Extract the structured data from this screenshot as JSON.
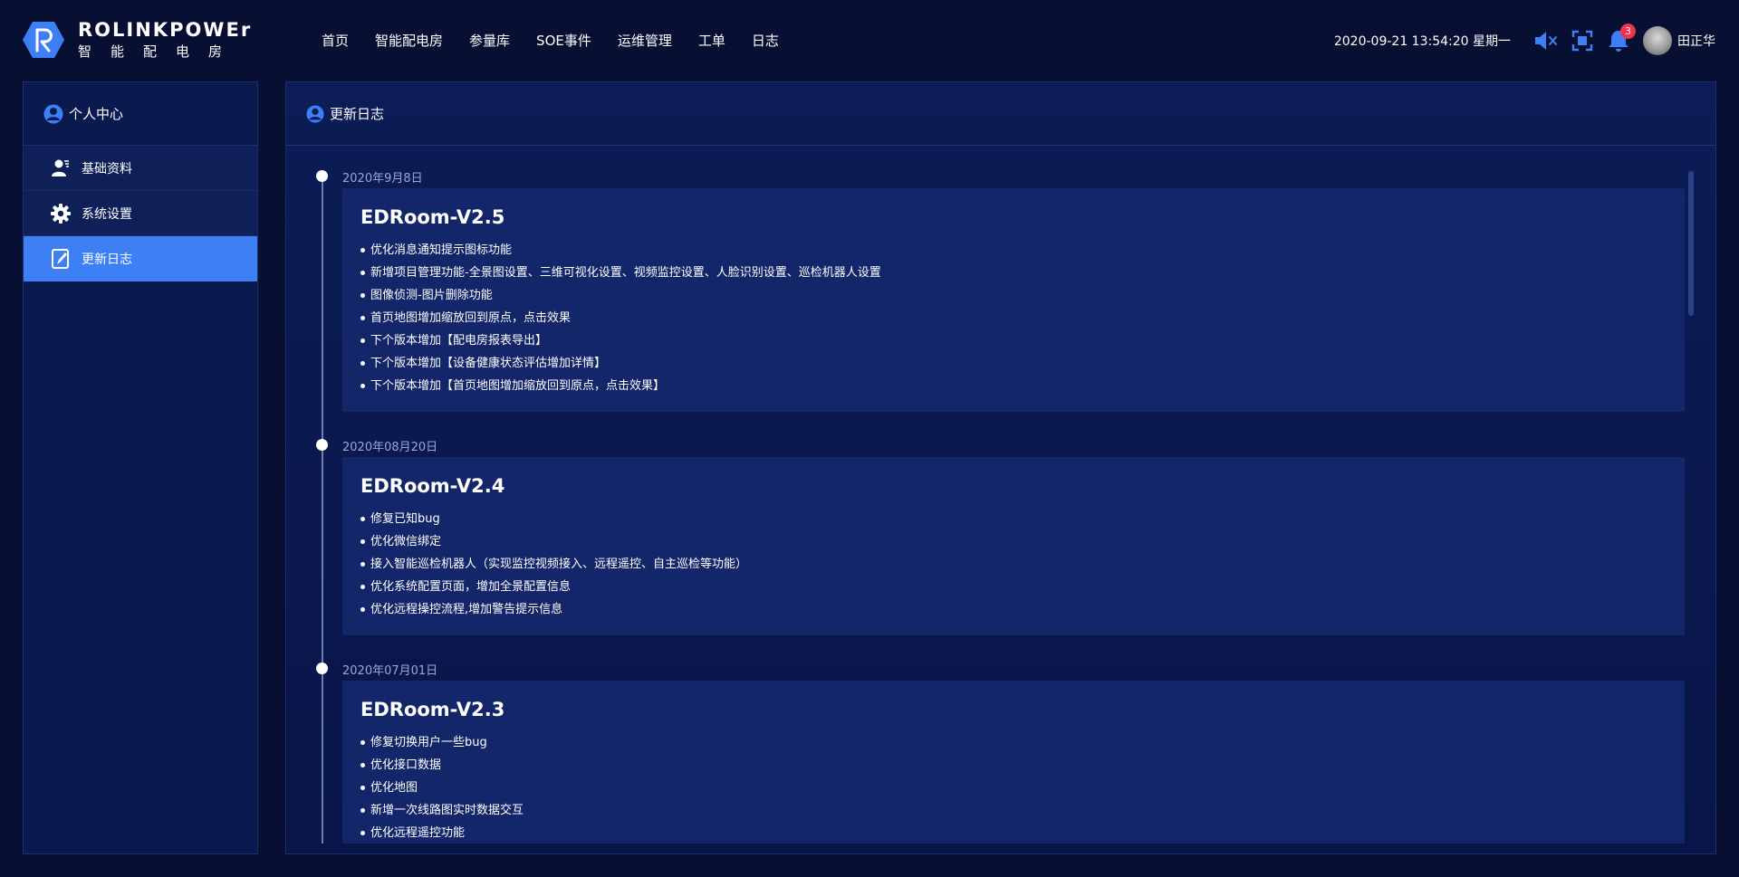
{
  "header": {
    "brand": "ROLINKPOWEr",
    "brand_sub": "智能配电房",
    "nav": [
      "首页",
      "智能配电房",
      "参量库",
      "SOE事件",
      "运维管理",
      "工单",
      "日志"
    ],
    "datetime": "2020-09-21 13:54:20 星期一",
    "notification_count": "3",
    "username": "田正华",
    "icons": [
      "mute-icon",
      "fullscreen-icon",
      "bell-icon"
    ]
  },
  "sidebar": {
    "title": "个人中心",
    "items": [
      {
        "label": "基础资料",
        "icon": "user-info-icon"
      },
      {
        "label": "系统设置",
        "icon": "gear-icon"
      },
      {
        "label": "更新日志",
        "icon": "notebook-icon",
        "active": true
      }
    ]
  },
  "main": {
    "title": "更新日志",
    "entries": [
      {
        "date": "2020年9月8日",
        "version": "EDRoom-V2.5",
        "items": [
          "优化消息通知提示图标功能",
          "新增项目管理功能-全景图设置、三维可视化设置、视频监控设置、人脸识别设置、巡检机器人设置",
          "图像侦测-图片删除功能",
          "首页地图增加缩放回到原点，点击效果",
          "下个版本增加【配电房报表导出】",
          "下个版本增加【设备健康状态评估增加详情】",
          "下个版本增加【首页地图增加缩放回到原点，点击效果】"
        ]
      },
      {
        "date": "2020年08月20日",
        "version": "EDRoom-V2.4",
        "items": [
          "修复已知bug",
          "优化微信绑定",
          "接入智能巡检机器人（实现监控视频接入、远程遥控、自主巡检等功能）",
          "优化系统配置页面，增加全景配置信息",
          "优化远程操控流程,增加警告提示信息"
        ]
      },
      {
        "date": "2020年07月01日",
        "version": "EDRoom-V2.3",
        "items": [
          "修复切换用户一些bug",
          "优化接口数据",
          "优化地图",
          "新增一次线路图实时数据交互",
          "优化远程遥控功能"
        ]
      }
    ]
  },
  "colors": {
    "background": "#070f33",
    "panel": "#0a1a4f",
    "card": "#14266a",
    "accent": "#3d7ff5",
    "badge": "#f0334a"
  }
}
